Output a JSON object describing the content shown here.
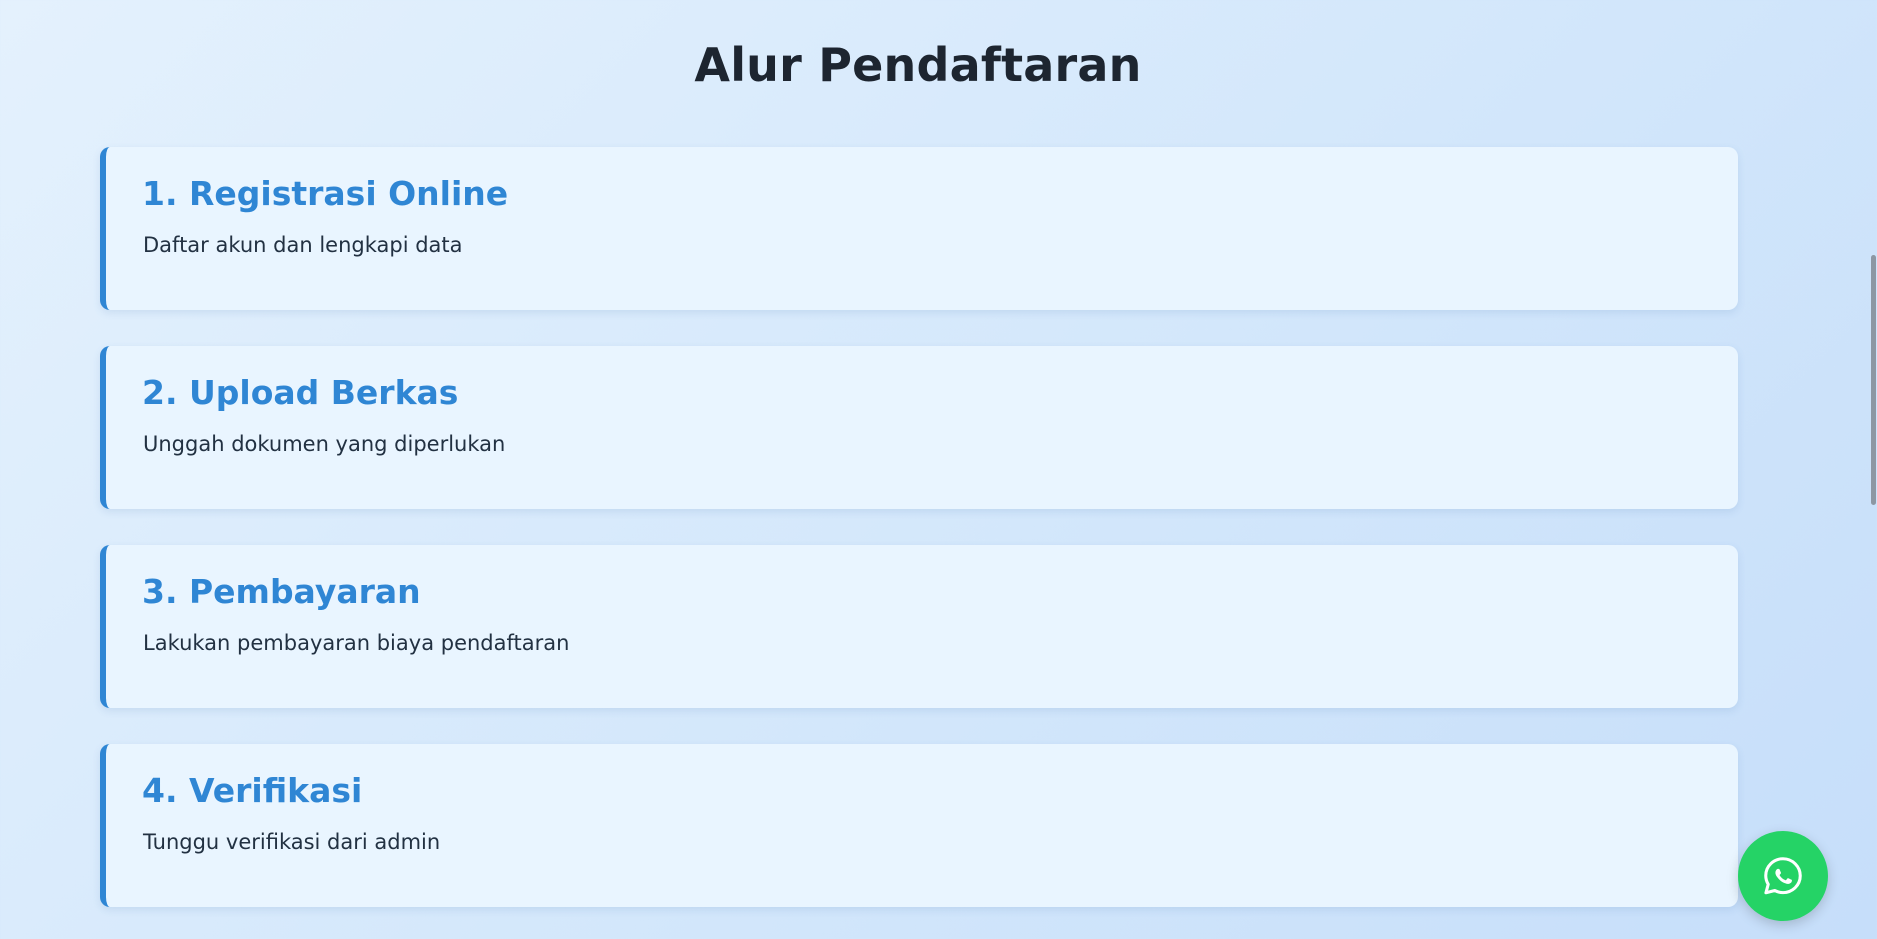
{
  "section": {
    "title": "Alur Pendaftaran"
  },
  "steps": [
    {
      "title": "1. Registrasi Online",
      "description": "Daftar akun dan lengkapi data"
    },
    {
      "title": "2. Upload Berkas",
      "description": "Unggah dokumen yang diperlukan"
    },
    {
      "title": "3. Pembayaran",
      "description": "Lakukan pembayaran biaya pendaftaran"
    },
    {
      "title": "4. Verifikasi",
      "description": "Tunggu verifikasi dari admin"
    }
  ],
  "floating_button": {
    "icon": "whatsapp-icon",
    "color": "#25d366"
  },
  "colors": {
    "accent": "#2f86d4",
    "card_background": "#e9f5ff",
    "heading": "#1d2530"
  }
}
